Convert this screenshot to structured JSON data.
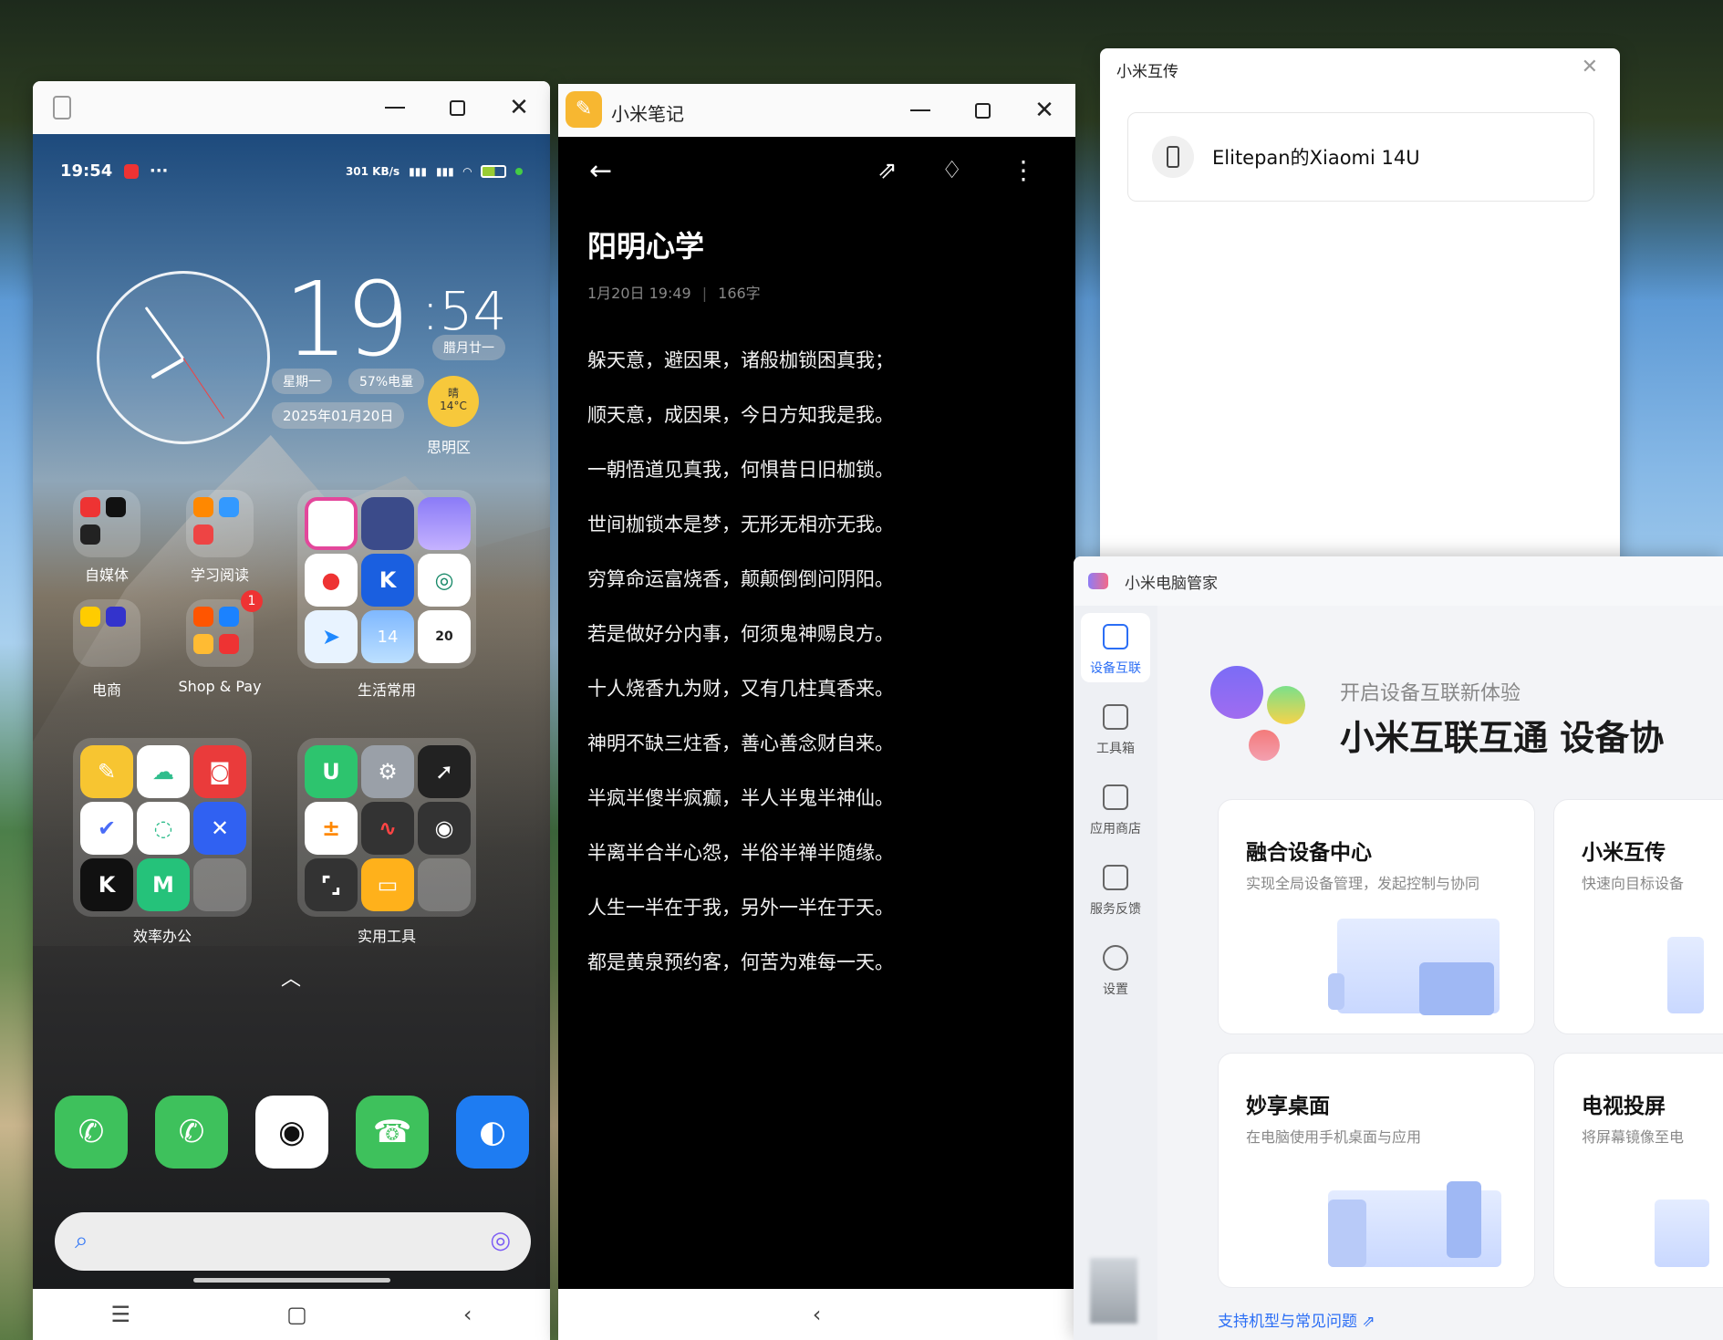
{
  "phone_window": {
    "status_time": "19:54",
    "status_more": "···",
    "net_speed": "301 KB/s",
    "clock_widget": {
      "hours": "19",
      "minutes": ":54",
      "lunar": "腊月廿一",
      "weekday": "星期一",
      "battery": "57%电量",
      "date": "2025年01月20日",
      "weather_cond": "晴",
      "weather_temp": "14°C",
      "district": "思明区"
    },
    "folders": [
      "自媒体",
      "学习阅读",
      "电商",
      "Shop & Pay",
      "生活常用",
      "效率办公",
      "实用工具"
    ],
    "badge_count": "1",
    "weather_icon_num": "14",
    "calendar_icon_num": "20"
  },
  "notes_window": {
    "app_title": "小米笔记",
    "note_title": "阳明心学",
    "note_date": "1月20日 19:49",
    "note_count": "166字",
    "lines": [
      "躲天意，避因果，诸般枷锁困真我；",
      "顺天意，成因果，今日方知我是我。",
      "一朝悟道见真我，何惧昔日旧枷锁。",
      "世间枷锁本是梦，无形无相亦无我。",
      "穷算命运富烧香，颠颠倒倒问阴阳。",
      "若是做好分内事，何须鬼神赐良方。",
      "十人烧香九为财，又有几柱真香来。",
      "神明不缺三炷香，善心善念财自来。",
      "半疯半傻半疯癫，半人半鬼半神仙。",
      "半离半合半心怨，半俗半禅半随缘。",
      "人生一半在于我，另外一半在于天。",
      "都是黄泉预约客，何苦为难每一天。"
    ]
  },
  "share_window": {
    "title": "小米互传",
    "device": "Elitepan的Xiaomi 14U"
  },
  "manager_window": {
    "title": "小米电脑管家",
    "sidebar": [
      "设备互联",
      "工具箱",
      "应用商店",
      "服务反馈",
      "设置"
    ],
    "subtitle": "开启设备互联新体验",
    "headline": "小米互联互通 设备协",
    "cards": [
      {
        "title": "融合设备中心",
        "desc": "实现全局设备管理，发起控制与协同"
      },
      {
        "title": "小米互传",
        "desc": "快速向目标设备"
      },
      {
        "title": "妙享桌面",
        "desc": "在电脑使用手机桌面与应用"
      },
      {
        "title": "电视投屏",
        "desc": "将屏幕镜像至电"
      }
    ],
    "footer_link": "支持机型与常见问题"
  },
  "colors": {
    "accent": "#2b6ef5",
    "notes_accent": "#f7b731",
    "wechat": "#3ec15c"
  }
}
